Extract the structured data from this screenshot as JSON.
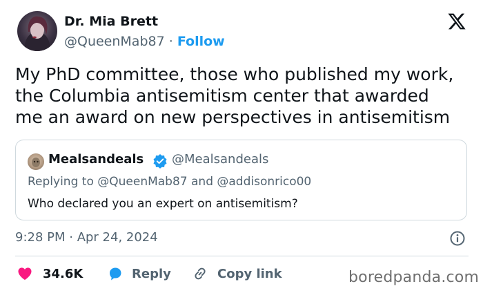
{
  "author": {
    "name": "Dr. Mia Brett",
    "handle": "@QueenMab87",
    "separator": "·",
    "follow_label": "Follow"
  },
  "logo_icon": "x-logo-icon",
  "tweet": {
    "lines": [
      "My PhD committee, those who published my work,",
      "the Columbia antisemitism center that awarded",
      "me an award on new perspectives in antisemitism"
    ]
  },
  "quote": {
    "name": "Mealsandeals",
    "handle": "@Mealsandeals",
    "replying_to": "Replying to @QueenMab87 and @addisonrico00",
    "text": "Who declared you an expert on antisemitism?",
    "verified_icon": "verified-badge-icon"
  },
  "timestamp": "9:28 PM · Apr 24, 2024",
  "actions": {
    "like_count": "34.6K",
    "reply_label": "Reply",
    "copy_label": "Copy link"
  },
  "watermark": "boredpanda.com",
  "colors": {
    "accent": "#1d9bf0",
    "like": "#f91880",
    "secondary_text": "#536471",
    "border": "#cfd9de"
  }
}
